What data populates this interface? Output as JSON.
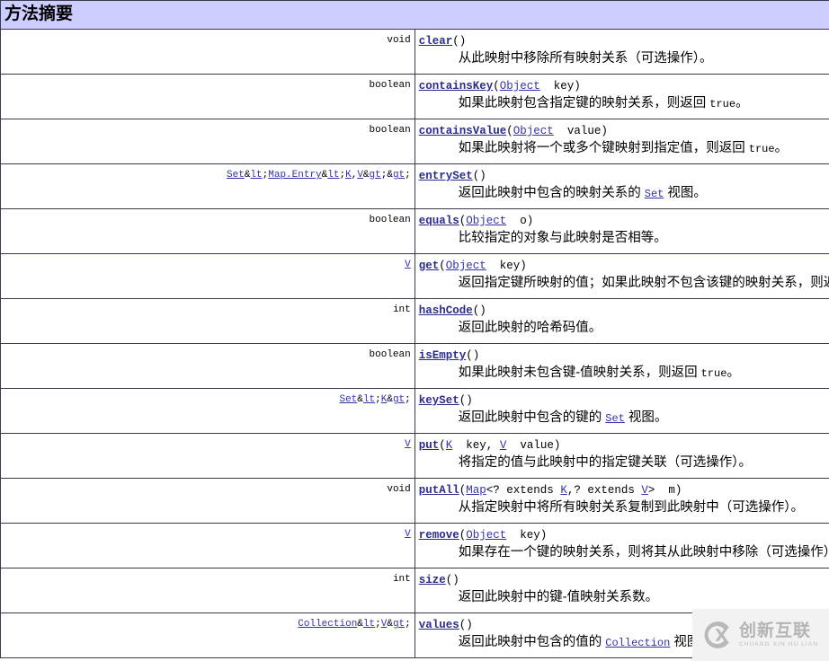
{
  "summary": {
    "title": "方法摘要",
    "header_bg": "#CCCCFF",
    "link_color": "#3333AA",
    "border_color": "#3B3B4F"
  },
  "methods": [
    {
      "return_type": "void",
      "return_type_link": false,
      "name": "clear",
      "params": "()",
      "description": "从此映射中移除所有映射关系（可选操作）。"
    },
    {
      "return_type": "boolean",
      "return_type_link": false,
      "name": "containsKey",
      "params": "(Object  key)",
      "description": "如果此映射包含指定键的映射关系，则返回 true。"
    },
    {
      "return_type": "boolean",
      "return_type_link": false,
      "name": "containsValue",
      "params": "(Object  value)",
      "description": "如果此映射将一个或多个键映射到指定值，则返回 true。"
    },
    {
      "return_type": "Set<Map.Entry<K,V>>",
      "return_type_link": true,
      "name": "entrySet",
      "params": "()",
      "description": "返回此映射中包含的映射关系的 Set 视图。"
    },
    {
      "return_type": "boolean",
      "return_type_link": false,
      "name": "equals",
      "params": "(Object  o)",
      "description": "比较指定的对象与此映射是否相等。"
    },
    {
      "return_type": "V",
      "return_type_link": true,
      "name": "get",
      "params": "(Object  key)",
      "description": "返回指定键所映射的值；如果此映射不包含该键的映射关系，则返回 null。"
    },
    {
      "return_type": "int",
      "return_type_link": false,
      "name": "hashCode",
      "params": "()",
      "description": "返回此映射的哈希码值。"
    },
    {
      "return_type": "boolean",
      "return_type_link": false,
      "name": "isEmpty",
      "params": "()",
      "description": "如果此映射未包含键-值映射关系，则返回 true。"
    },
    {
      "return_type": "Set<K>",
      "return_type_link": true,
      "name": "keySet",
      "params": "()",
      "description": "返回此映射中包含的键的 Set 视图。"
    },
    {
      "return_type": "V",
      "return_type_link": true,
      "name": "put",
      "params": "(K  key, V  value)",
      "description": "将指定的值与此映射中的指定键关联（可选操作）。"
    },
    {
      "return_type": "void",
      "return_type_link": false,
      "name": "putAll",
      "params": "(Map<? extends K,? extends V>  m)",
      "description": "从指定映射中将所有映射关系复制到此映射中（可选操作）。"
    },
    {
      "return_type": "V",
      "return_type_link": true,
      "name": "remove",
      "params": "(Object  key)",
      "description": "如果存在一个键的映射关系，则将其从此映射中移除（可选操作）。"
    },
    {
      "return_type": "int",
      "return_type_link": false,
      "name": "size",
      "params": "()",
      "description": "返回此映射中的键-值映射关系数。"
    },
    {
      "return_type": "Collection<V>",
      "return_type_link": true,
      "name": "values",
      "params": "()",
      "description": "返回此映射中包含的值的 Collection 视图。"
    }
  ],
  "watermark": {
    "logo": "circled-x-logo",
    "text_cn": "创新互联",
    "text_en": "CHUANG XIN HU LIAN"
  }
}
